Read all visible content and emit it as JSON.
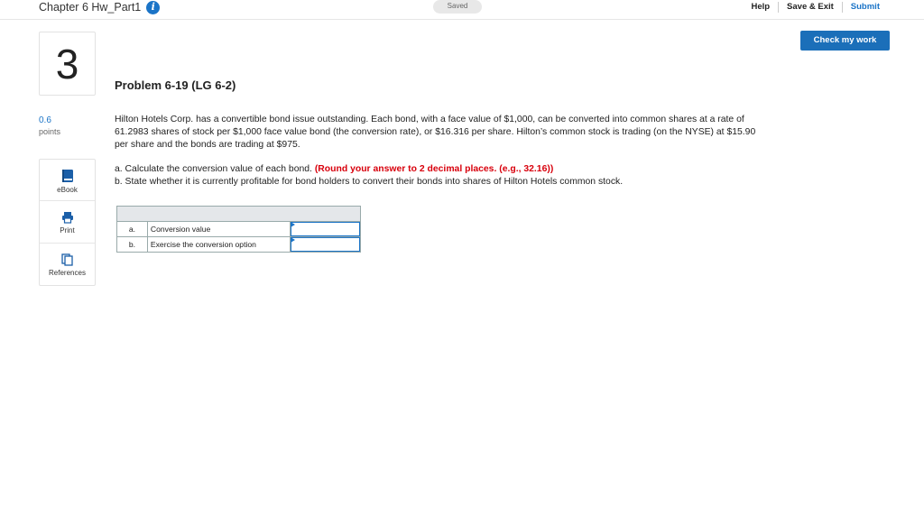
{
  "header": {
    "assignment_title": "Chapter 6 Hw_Part1",
    "saved_status": "Saved",
    "help_label": "Help",
    "save_exit_label": "Save & Exit",
    "submit_label": "Submit",
    "check_label": "Check my work"
  },
  "question": {
    "number": "3",
    "points_value": "0.6",
    "points_label": "points"
  },
  "tools": [
    {
      "label": "eBook",
      "icon": "ebook-icon"
    },
    {
      "label": "Print",
      "icon": "print-icon"
    },
    {
      "label": "References",
      "icon": "references-icon"
    }
  ],
  "problem": {
    "title": "Problem 6-19 (LG 6-2)",
    "intro": "Hilton Hotels Corp. has a convertible bond issue outstanding. Each bond, with a face value of $1,000, can be converted into common shares at a rate of 61.2983 shares of stock per $1,000 face value bond (the conversion rate), or $16.316 per share. Hilton’s common stock is trading (on the NYSE) at $15.90 per share and the bonds are trading at $975.",
    "part_a_text": "a. Calculate the conversion value of each bond.",
    "part_a_hint": "(Round your answer to 2 decimal places. (e.g., 32.16))",
    "part_b_text": "b. State whether it is currently profitable for bond holders to convert their bonds into shares of Hilton Hotels common stock."
  },
  "answer_table": {
    "rows": [
      {
        "letter": "a.",
        "label": "Conversion value",
        "value": ""
      },
      {
        "letter": "b.",
        "label": "Exercise the conversion option",
        "value": ""
      }
    ]
  },
  "colors": {
    "accent": "#1b74c7",
    "hint_red": "#d8000c"
  }
}
